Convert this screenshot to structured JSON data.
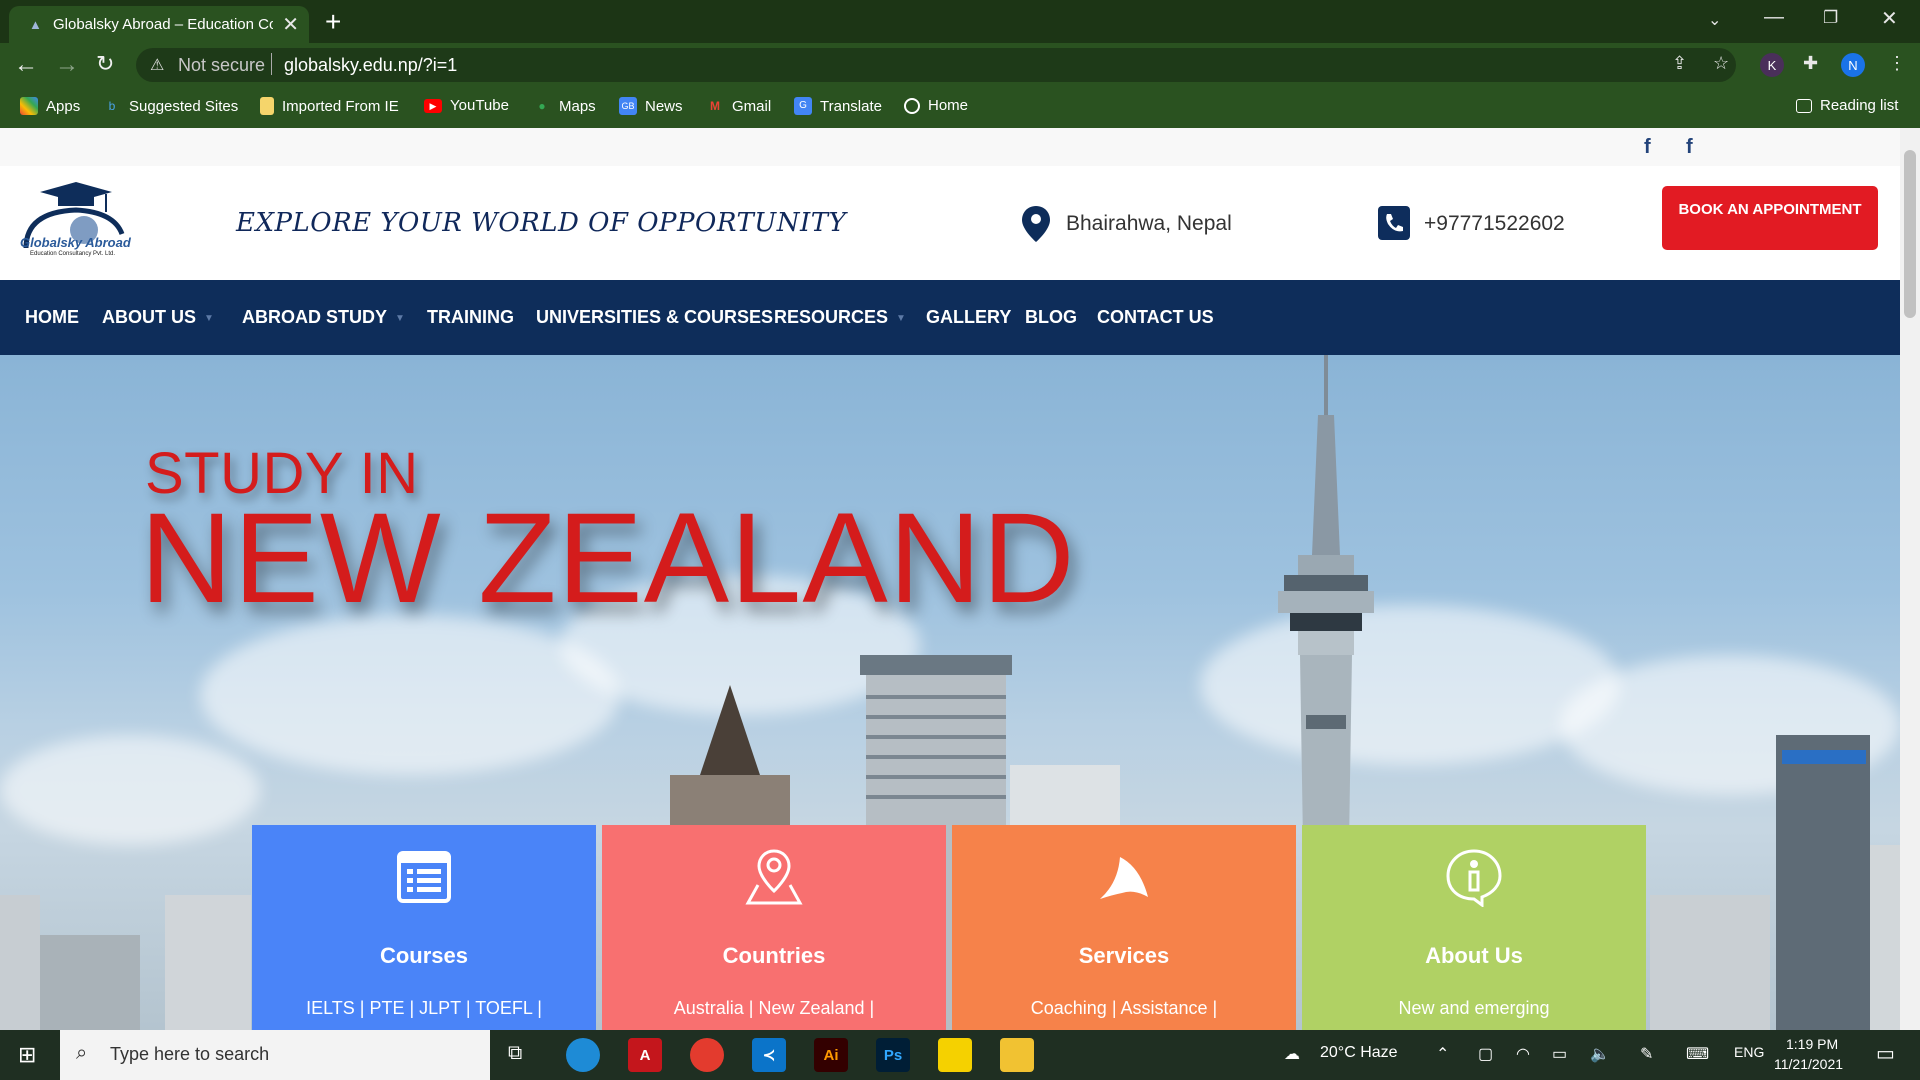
{
  "browser": {
    "tab_title": "Globalsky Abroad – Education Co",
    "url_security": "Not secure",
    "url": "globalsky.edu.np/?i=1",
    "profile_initial_k": "K",
    "profile_initial_n": "N",
    "bookmarks": [
      "Apps",
      "Suggested Sites",
      "Imported From IE",
      "YouTube",
      "Maps",
      "News",
      "Gmail",
      "Translate",
      "Home"
    ],
    "reading_list": "Reading list"
  },
  "site": {
    "logo_name": "Globalsky Abroad",
    "logo_sub": "Education Consultancy Pvt. Ltd.",
    "tagline": "EXPLORE YOUR WORLD OF OPPORTUNITY",
    "location": "Bhairahwa, Nepal",
    "phone": "+97771522602",
    "book_button": "BOOK AN APPOINTMENT",
    "nav": [
      "HOME",
      "ABOUT US",
      "ABROAD STUDY",
      "TRAINING",
      "UNIVERSITIES & COURSES",
      "RESOURCES",
      "GALLERY",
      "BLOG",
      "CONTACT US"
    ],
    "hero_small": "STUDY IN",
    "hero_big": "NEW ZEALAND",
    "cards": [
      {
        "title": "Courses",
        "sub": "IELTS | PTE | JLPT | TOEFL |",
        "color": "#4a84f8"
      },
      {
        "title": "Countries",
        "sub": "Australia | New Zealand |",
        "color": "#f87070"
      },
      {
        "title": "Services",
        "sub": "Coaching | Assistance |",
        "color": "#f6824a"
      },
      {
        "title": "About Us",
        "sub": "New and emerging",
        "color": "#b0d164"
      }
    ]
  },
  "taskbar": {
    "search_placeholder": "Type here to search",
    "weather": "20°C  Haze",
    "lang": "ENG",
    "time": "1:19 PM",
    "date": "11/21/2021",
    "apps": [
      "Ai",
      "Ps"
    ]
  }
}
